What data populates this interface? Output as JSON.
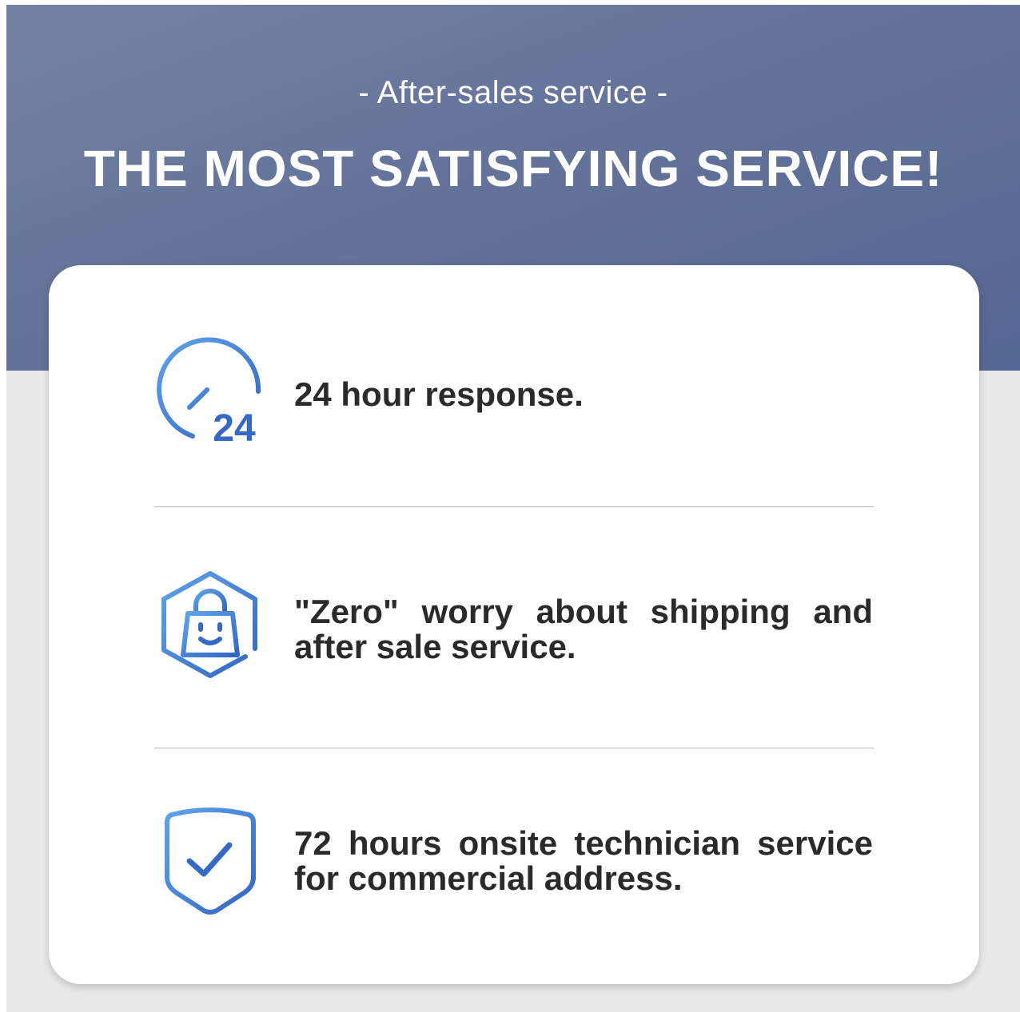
{
  "header": {
    "subtitle": "- After-sales service -",
    "title": "THE MOST SATISFYING SERVICE!"
  },
  "features": [
    {
      "icon": "clock-24-icon",
      "text": "24 hour response."
    },
    {
      "icon": "shopping-bag-hexagon-icon",
      "text": "\"Zero\" worry about shipping and after sale service."
    },
    {
      "icon": "shield-check-icon",
      "text": "72 hours onsite technician service for commercial address."
    }
  ],
  "icon_24_label": "24",
  "colors": {
    "banner": "#64739a",
    "icon_light": "#5b9de6",
    "icon_dark": "#3569c6",
    "text": "#2a2a2a",
    "background": "#e9e9e9"
  }
}
